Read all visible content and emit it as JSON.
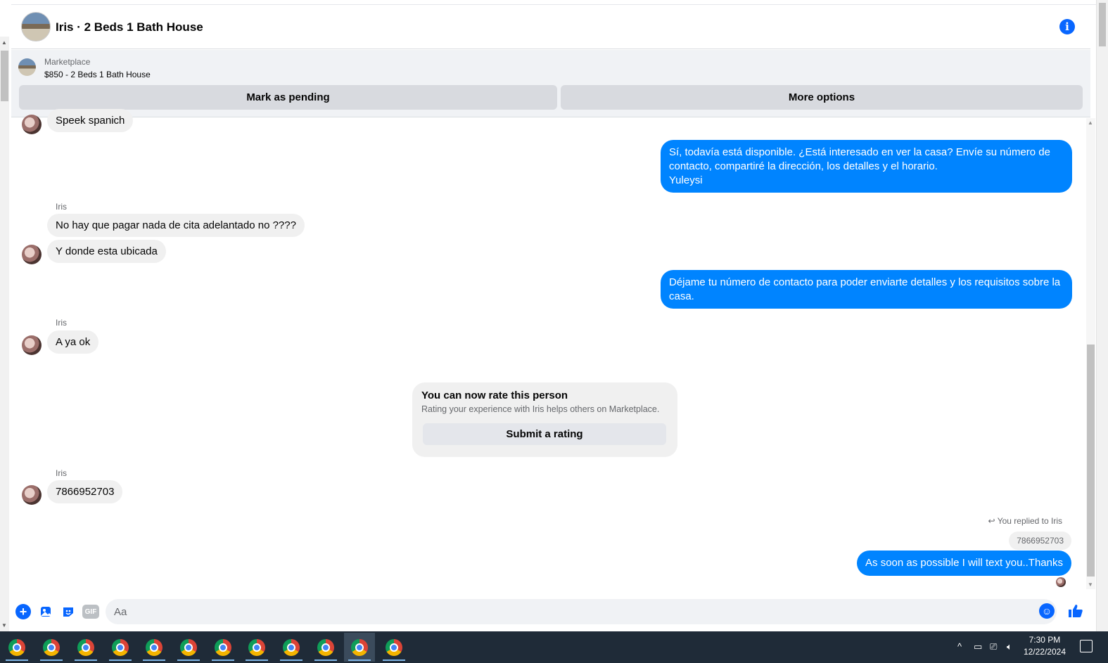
{
  "header": {
    "title": "Iris · 2 Beds 1 Bath House"
  },
  "marketplace": {
    "label": "Marketplace",
    "listing": "$850 - 2 Beds 1 Bath House",
    "pending_button": "Mark as pending",
    "more_button": "More options"
  },
  "messages": {
    "m1": "Speek spanich",
    "m2": "Sí, todavía está disponible. ¿Está interesado en ver la casa? Envíe su número de contacto, compartiré la dirección, los detalles y el horario.",
    "m2_sign": "Yuleysi",
    "sender1": "Iris",
    "m3": "No hay que pagar nada de cita adelantado no ????",
    "m4": "Y donde esta ubicada",
    "m5": "Déjame tu número de contacto para poder enviarte detalles y los requisitos sobre la casa.",
    "sender2": "Iris",
    "m6": "A ya ok",
    "sender3": "Iris",
    "m7": "7866952703",
    "reply_note": "You replied to Iris",
    "reply_quote": "7866952703",
    "m8": "As soon as possible I will text you..Thanks"
  },
  "rating": {
    "title": "You can now rate this person",
    "subtitle": "Rating your experience with Iris helps others on Marketplace.",
    "button": "Submit a rating"
  },
  "composer": {
    "placeholder": "Aa",
    "gif_label": "GIF"
  },
  "taskbar": {
    "time": "7:30 PM",
    "date": "12/22/2024"
  },
  "colors": {
    "accent": "#0866ff",
    "outgoing_bubble": "#0084ff",
    "incoming_bubble": "#f0f0f0",
    "taskbar": "#1f2b38"
  }
}
